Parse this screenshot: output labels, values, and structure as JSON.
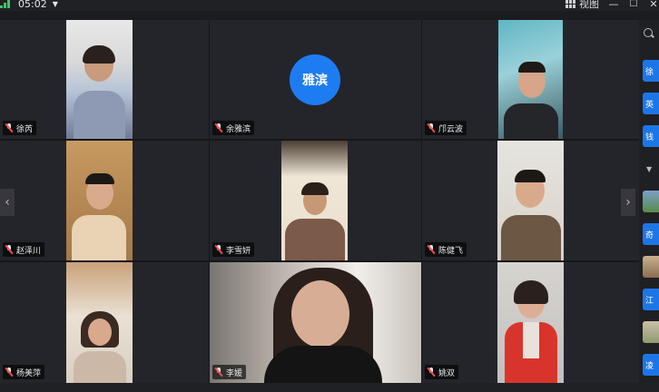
{
  "titlebar": {
    "time": "05:02",
    "view_label": "视图",
    "dropdown_icon": "chevron-down-icon",
    "window_buttons": [
      "minimize",
      "maximize",
      "close"
    ]
  },
  "participants": [
    {
      "name": "徐芮"
    },
    {
      "name": "余雅滨",
      "avatar_text": "雅滨"
    },
    {
      "name": "邝云波"
    },
    {
      "name": "赵泽川"
    },
    {
      "name": "李雪妍"
    },
    {
      "name": "陈健飞"
    },
    {
      "name": "杨美萍"
    },
    {
      "name": "李媛"
    },
    {
      "name": "姚双"
    }
  ],
  "sidebar": {
    "chips": [
      "徐",
      "英",
      "钱",
      "奇",
      "江",
      "凌"
    ]
  },
  "colors": {
    "accent": "#1e7cf2",
    "background": "#16171a",
    "tile": "#24252a",
    "mic_muted": "#ff4d4f"
  }
}
